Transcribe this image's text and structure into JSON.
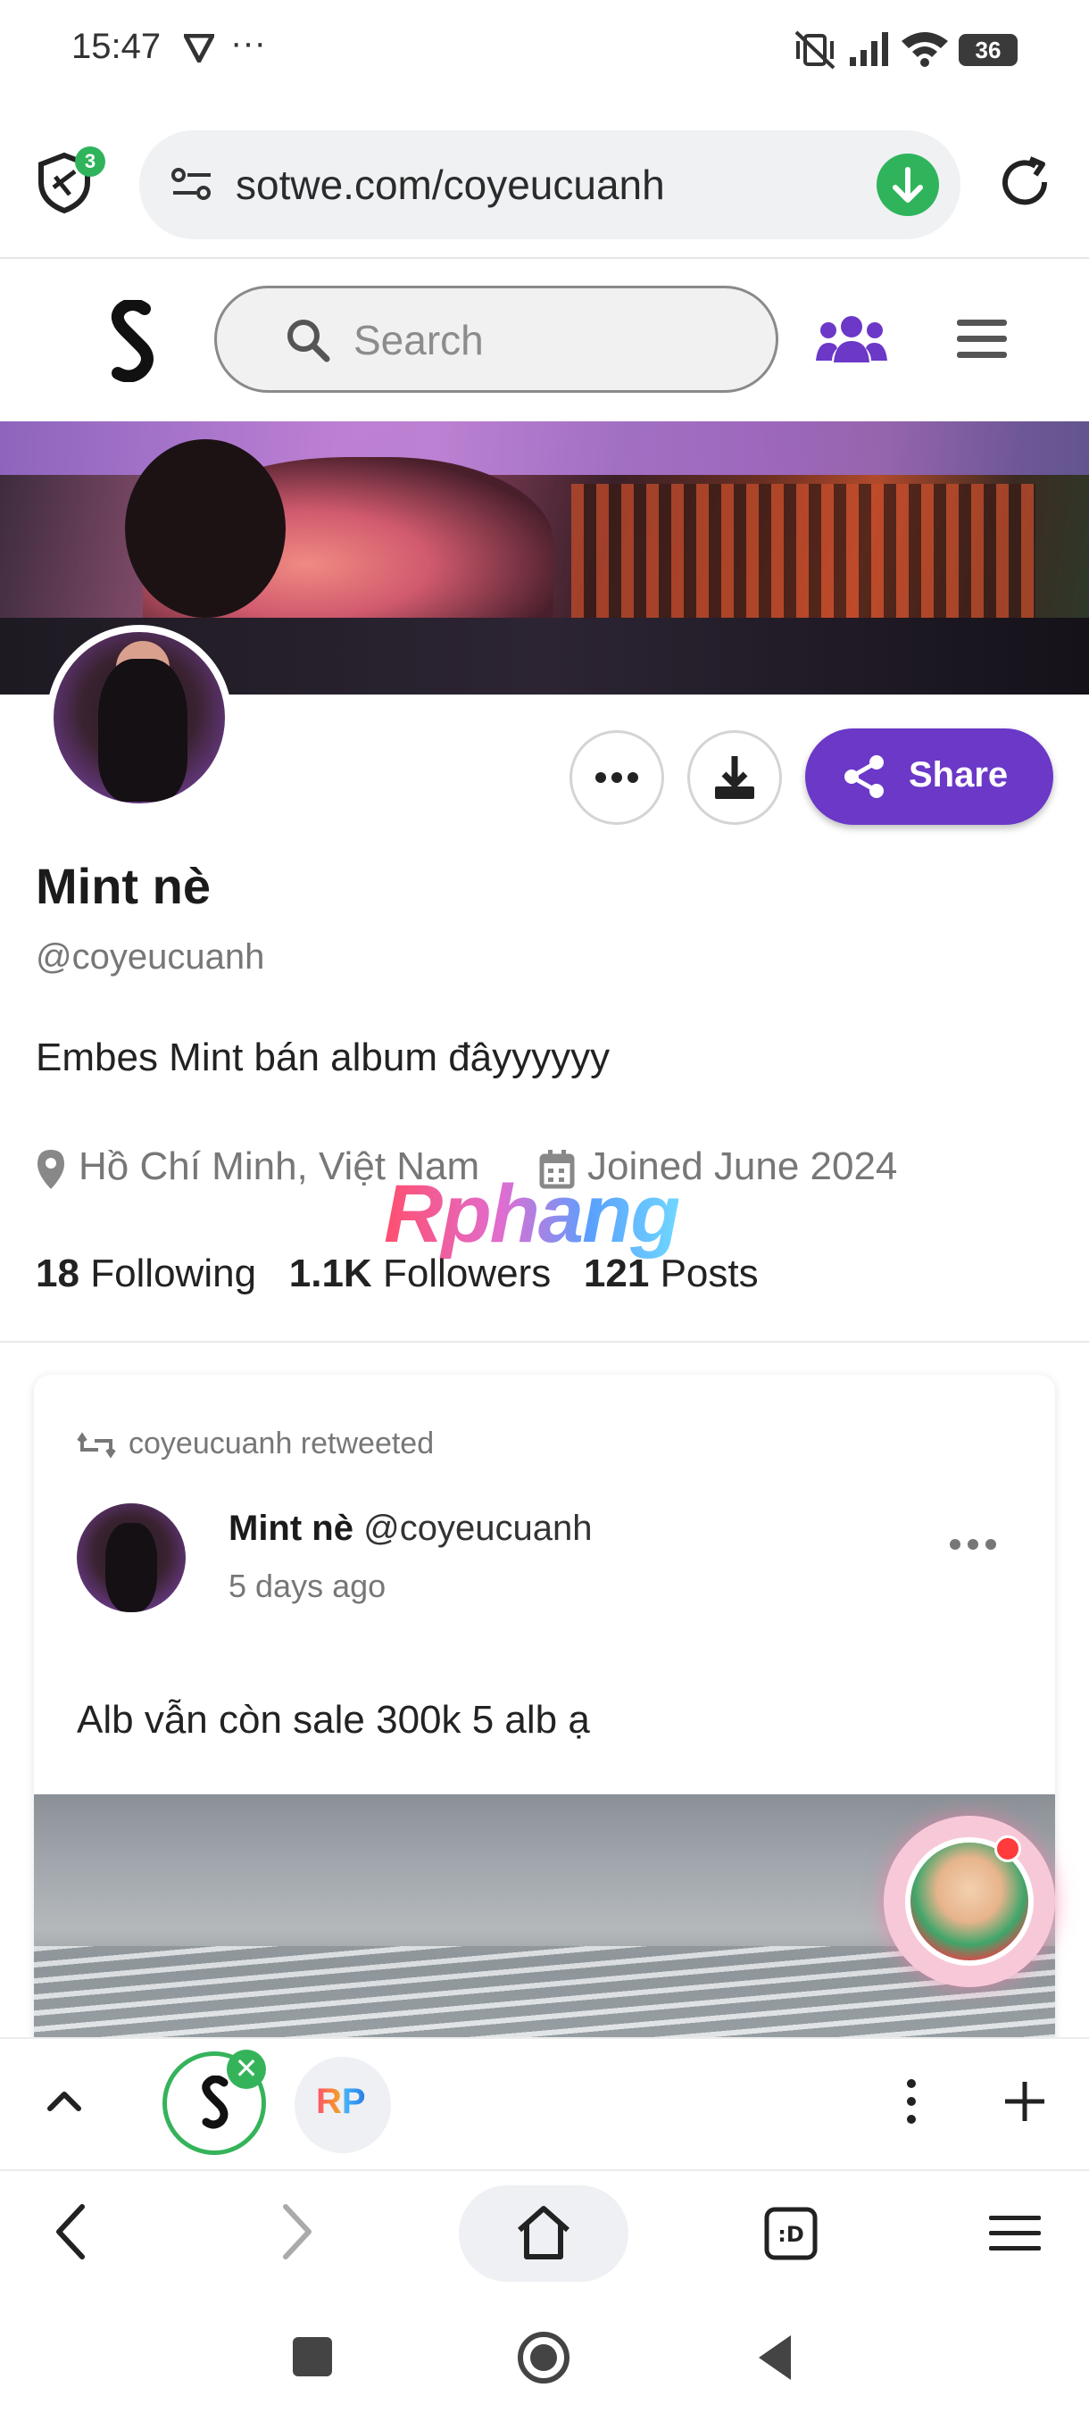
{
  "status_bar": {
    "time": "15:47",
    "extra": "···",
    "battery": "36"
  },
  "browser": {
    "url": "sotwe.com/coyeucuanh",
    "shield_count": "3"
  },
  "site": {
    "search_placeholder": "Search"
  },
  "profile": {
    "name": "Mint nè",
    "handle": "@coyeucuanh",
    "bio": "Embes Mint bán album đâyyyyyy",
    "location": "Hồ Chí Minh, Việt Nam",
    "joined": "Joined June 2024",
    "share_label": "Share",
    "stats": {
      "following_count": "18",
      "following_label": "Following",
      "followers_count": "1.1K",
      "followers_label": "Followers",
      "posts_count": "121",
      "posts_label": "Posts"
    }
  },
  "watermark": "Rphang",
  "post": {
    "retweet_text": "coyeucuanh retweeted",
    "author_name": "Mint nè",
    "author_handle": "@coyeucuanh",
    "time": "5 days ago",
    "text": "Alb vẫn còn sale 300k 5 alb ạ"
  },
  "tabs": {
    "close_glyph": "✕",
    "rp_label": "RP"
  },
  "colors": {
    "accent": "#6b38c8",
    "green": "#2fb45c"
  }
}
